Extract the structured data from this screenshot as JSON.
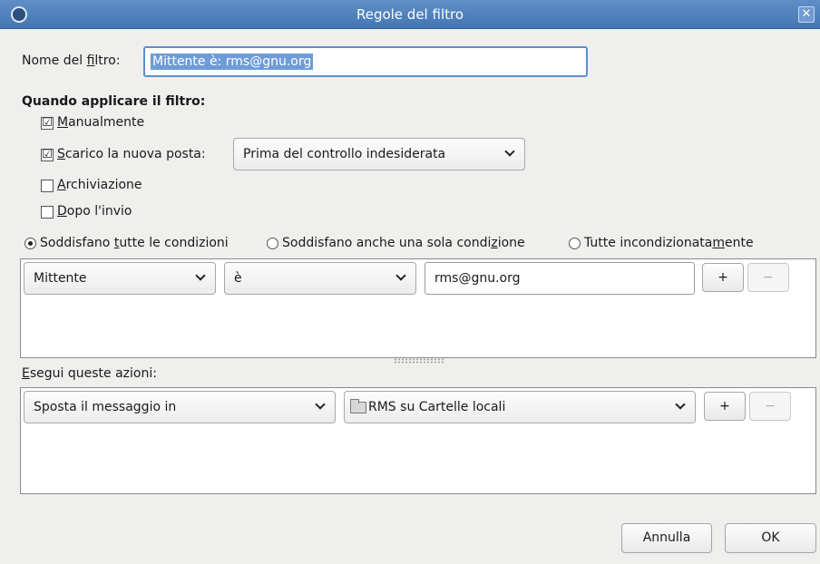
{
  "window": {
    "title": "Regole del filtro",
    "close_glyph": "✕"
  },
  "filter_name": {
    "label_pre": "Nome del ",
    "label_ul": "f",
    "label_post": "iltro:",
    "value": "Mittente è: rms@gnu.org"
  },
  "when": {
    "heading": "Quando applicare il filtro:",
    "manual": {
      "ul": "M",
      "rest": "anualmente",
      "checked": true
    },
    "download": {
      "ul": "S",
      "rest": "carico la nuova posta:",
      "checked": true,
      "option": "Prima del controllo indesiderata"
    },
    "archive": {
      "ul": "A",
      "rest": "rchiviazione",
      "checked": false
    },
    "after_send": {
      "ul": "D",
      "rest": "opo l'invio",
      "checked": false
    }
  },
  "match": {
    "all": {
      "pre": "Soddisfano ",
      "ul": "t",
      "post": "utte le condizioni",
      "selected": true
    },
    "any": {
      "pre": "Soddisfano anche una sola condi",
      "ul": "z",
      "post": "ione",
      "selected": false
    },
    "unconditional": {
      "pre": "Tutte incondizionata",
      "ul": "m",
      "post": "ente",
      "selected": false
    }
  },
  "condition": {
    "field": "Mittente",
    "operator": "è",
    "value": "rms@gnu.org",
    "add_label": "+",
    "remove_label": "−"
  },
  "actions": {
    "label_ul": "E",
    "label_rest": "segui queste azioni:",
    "action": "Sposta il messaggio in",
    "target": "RMS su Cartelle locali",
    "add_label": "+",
    "remove_label": "−"
  },
  "footer": {
    "cancel": "Annulla",
    "ok": "OK"
  },
  "icons": {
    "check": "☑",
    "folder": "folder-icon"
  },
  "colors": {
    "titlebar": "#4f80bd",
    "selection": "#6d9cd8",
    "focus_border": "#5e8ed0"
  }
}
